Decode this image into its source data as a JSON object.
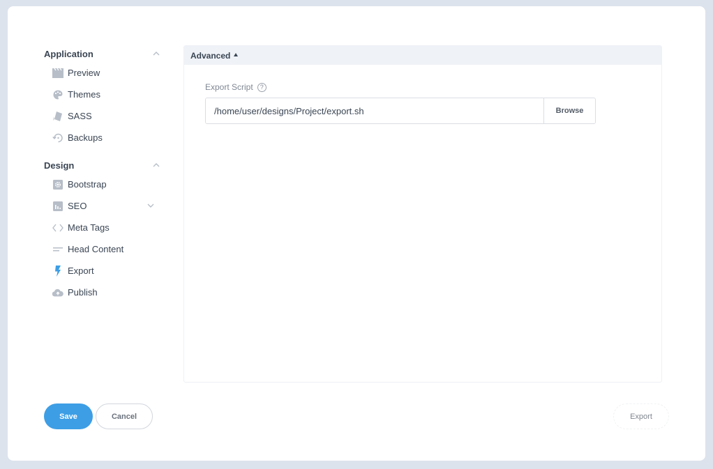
{
  "sidebar": {
    "sections": [
      {
        "title": "Application",
        "expanded": true,
        "items": [
          {
            "label": "Preview",
            "icon": "film-clapper-icon"
          },
          {
            "label": "Themes",
            "icon": "palette-icon"
          },
          {
            "label": "SASS",
            "icon": "sass-cards-icon"
          },
          {
            "label": "Backups",
            "icon": "history-icon"
          }
        ]
      },
      {
        "title": "Design",
        "expanded": true,
        "items": [
          {
            "label": "Bootstrap",
            "icon": "gear-box-icon"
          },
          {
            "label": "SEO",
            "icon": "bar-chart-icon",
            "has_submenu": true
          },
          {
            "label": "Meta Tags",
            "icon": "code-brackets-icon"
          },
          {
            "label": "Head Content",
            "icon": "lines-icon"
          },
          {
            "label": "Export",
            "icon": "lightning-icon",
            "active": true
          },
          {
            "label": "Publish",
            "icon": "cloud-upload-icon"
          }
        ]
      }
    ]
  },
  "panel": {
    "header": "Advanced",
    "field_label": "Export Script",
    "help_glyph": "?",
    "script_path": "/home/user/designs/Project/export.sh",
    "browse_label": "Browse"
  },
  "footer": {
    "save_label": "Save",
    "cancel_label": "Cancel",
    "export_label": "Export"
  },
  "colors": {
    "accent": "#3d9ee5",
    "icon_gray": "#b7bec8",
    "text": "#3a4553",
    "page_bg": "#dde3ec"
  }
}
